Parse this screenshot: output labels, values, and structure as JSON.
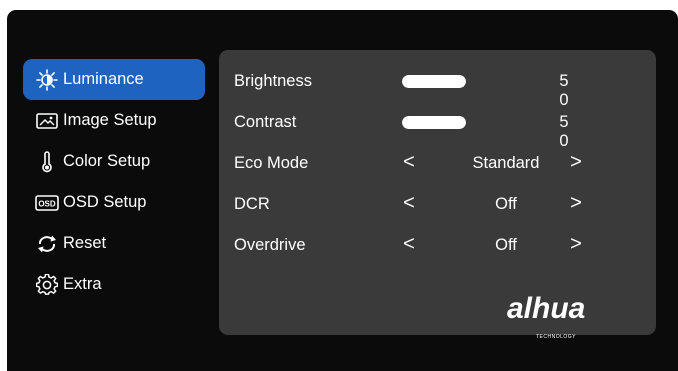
{
  "sidebar": {
    "items": [
      {
        "label": "Luminance",
        "icon": "sun-icon",
        "active": true
      },
      {
        "label": "Image Setup",
        "icon": "image-icon",
        "active": false
      },
      {
        "label": "Color Setup",
        "icon": "thermometer-icon",
        "active": false
      },
      {
        "label": "OSD Setup",
        "icon": "osd-icon",
        "active": false
      },
      {
        "label": "Reset",
        "icon": "reset-icon",
        "active": false
      },
      {
        "label": "Extra",
        "icon": "gear-icon",
        "active": false
      }
    ]
  },
  "panel": {
    "brightness": {
      "label": "Brightness",
      "value": "5 0",
      "level": 50
    },
    "contrast": {
      "label": "Contrast",
      "value": "5 0",
      "level": 50
    },
    "eco_mode": {
      "label": "Eco Mode",
      "value": "Standard"
    },
    "dcr": {
      "label": "DCR",
      "value": "Off"
    },
    "overdrive": {
      "label": "Overdrive",
      "value": "Off"
    }
  },
  "arrows": {
    "left": "<",
    "right": ">"
  },
  "logo": {
    "brand": "alhua",
    "tagline": "TECHNOLOGY"
  },
  "colors": {
    "background": "#0b0b0b",
    "panel": "#3a3a3a",
    "accent": "#1f63c0",
    "text": "#ffffff"
  }
}
